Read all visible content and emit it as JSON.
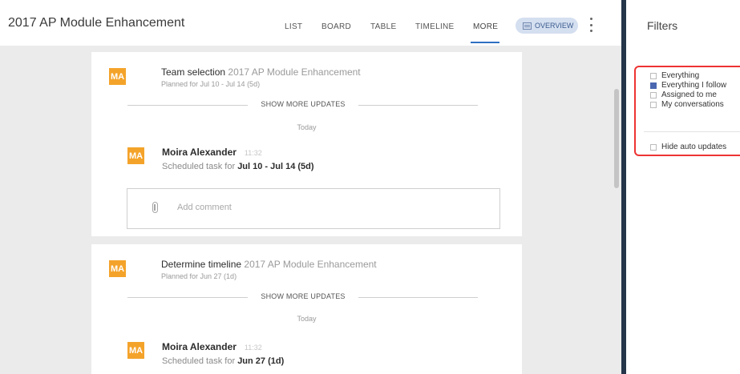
{
  "header": {
    "project_title": "2017 AP Module Enhancement",
    "tabs": [
      {
        "label": "LIST"
      },
      {
        "label": "BOARD"
      },
      {
        "label": "TABLE"
      },
      {
        "label": "TIMELINE"
      },
      {
        "label": "MORE"
      }
    ],
    "active_tab": "MORE",
    "overview_label": "OVERVIEW"
  },
  "feed": {
    "cards": [
      {
        "avatar": "MA",
        "task_name": "Team selection",
        "project": "2017 AP Module Enhancement",
        "planned": "Planned for Jul 10 - Jul 14 (5d)",
        "show_more": "SHOW MORE UPDATES",
        "day": "Today",
        "update": {
          "avatar": "MA",
          "author": "Moira Alexander",
          "time": "11:32",
          "prefix": "Scheduled task for",
          "dates": "Jul 10 - Jul 14 (5d)"
        },
        "comment_placeholder": "Add comment"
      },
      {
        "avatar": "MA",
        "task_name": "Determine timeline",
        "project": "2017 AP Module Enhancement",
        "planned": "Planned for Jun 27 (1d)",
        "show_more": "SHOW MORE UPDATES",
        "day": "Today",
        "update": {
          "avatar": "MA",
          "author": "Moira Alexander",
          "time": "11:32",
          "prefix": "Scheduled task for",
          "dates": "Jun 27 (1d)"
        }
      }
    ]
  },
  "filters": {
    "title": "Filters",
    "options": [
      {
        "label": "Everything",
        "checked": false
      },
      {
        "label": "Everything I follow",
        "checked": true
      },
      {
        "label": "Assigned to me",
        "checked": false
      },
      {
        "label": "My conversations",
        "checked": false
      }
    ],
    "hide_auto_updates": {
      "label": "Hide auto updates",
      "checked": false
    }
  },
  "colors": {
    "accent": "#2e6fc0",
    "avatar": "#f4a32a",
    "highlight_border": "#e33333",
    "panel_divider": "#25354a"
  },
  "icons": [
    "overview-icon",
    "more-vertical-icon",
    "paperclip-icon",
    "checkbox-icon"
  ]
}
